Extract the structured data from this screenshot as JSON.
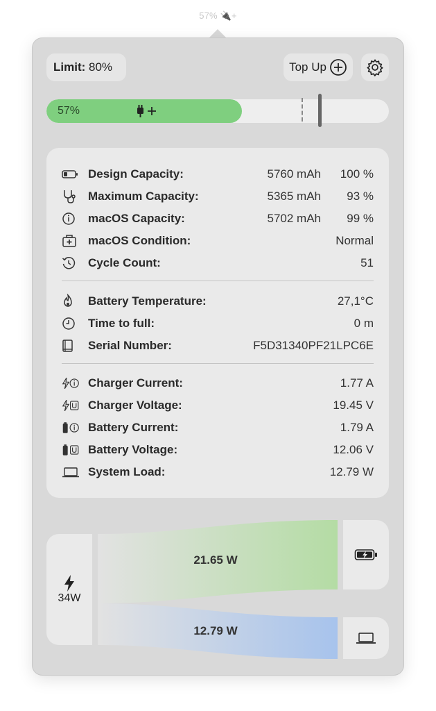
{
  "menubar": {
    "status": "57% 🔌+"
  },
  "header": {
    "limit_label": "Limit:",
    "limit_value": "80%",
    "topup_label": "Top Up"
  },
  "battery": {
    "percent_text": "57%",
    "charge_fraction": 0.57,
    "limit_fraction": 0.8
  },
  "info": {
    "rows": [
      {
        "label": "Design Capacity:",
        "value": "5760 mAh",
        "pct": "100 %",
        "icon": "battery-outline-icon"
      },
      {
        "label": "Maximum Capacity:",
        "value": "5365 mAh",
        "pct": "93 %",
        "icon": "stethoscope-icon"
      },
      {
        "label": "macOS Capacity:",
        "value": "5702 mAh",
        "pct": "99 %",
        "icon": "info-gauge-icon"
      },
      {
        "label": "macOS Condition:",
        "value": "Normal",
        "icon": "medical-kit-icon"
      },
      {
        "label": "Cycle Count:",
        "value": "51",
        "icon": "history-icon"
      },
      {
        "label": "Battery Temperature:",
        "value": "27,1°C",
        "icon": "flame-icon"
      },
      {
        "label": "Time to full:",
        "value": "0 m",
        "icon": "clock-icon"
      },
      {
        "label": "Serial Number:",
        "value": "F5D31340PF21LPC6E",
        "icon": "book-icon"
      },
      {
        "label": "Charger Current:",
        "value": "1.77 A",
        "icon": "bolt-info-icon"
      },
      {
        "label": "Charger Voltage:",
        "value": "19.45 V",
        "icon": "bolt-u-icon"
      },
      {
        "label": "Battery Current:",
        "value": "1.79 A",
        "icon": "battery-info-icon"
      },
      {
        "label": "Battery Voltage:",
        "value": "12.06 V",
        "icon": "battery-u-icon"
      },
      {
        "label": "System Load:",
        "value": "12.79 W",
        "icon": "laptop-icon"
      }
    ]
  },
  "flow": {
    "charger_watts": "34W",
    "to_battery": "21.65 W",
    "to_system": "12.79 W"
  },
  "colors": {
    "battery_fill": "#7fcf7f",
    "flow_battery": "#b8dca8",
    "flow_system": "#a9c4ec"
  }
}
